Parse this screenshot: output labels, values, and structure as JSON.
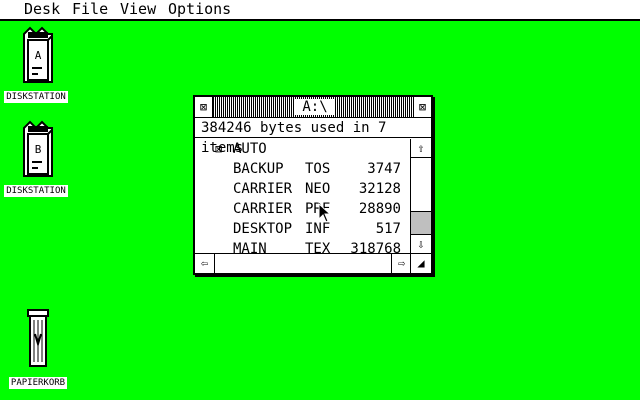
{
  "menubar": {
    "items": [
      "Desk",
      "File",
      "View",
      "Options"
    ]
  },
  "desktop": {
    "icons": [
      {
        "label": "DISKSTATION",
        "drive": "A",
        "type": "drive-icon"
      },
      {
        "label": "DISKSTATION",
        "drive": "B",
        "type": "drive-icon"
      },
      {
        "label": "PAPIERKORB",
        "type": "trash-icon"
      }
    ]
  },
  "window": {
    "title": "A:\\",
    "info": "384246 bytes used in 7 items",
    "close_glyph": "⊠",
    "full_glyph": "⊠",
    "files": [
      {
        "icon": "⊠",
        "name": "AUTO",
        "ext": "",
        "size": ""
      },
      {
        "icon": "",
        "name": "BACKUP",
        "ext": "TOS",
        "size": "3747"
      },
      {
        "icon": "",
        "name": "CARRIER",
        "ext": "NEO",
        "size": "32128"
      },
      {
        "icon": "",
        "name": "CARRIER",
        "ext": "PRF",
        "size": "28890"
      },
      {
        "icon": "",
        "name": "DESKTOP",
        "ext": "INF",
        "size": "517"
      },
      {
        "icon": "",
        "name": "MAIN",
        "ext": "TEX",
        "size": "318768"
      }
    ],
    "scroll": {
      "up": "⇧",
      "down": "⇩",
      "left": "⇦",
      "right": "⇨",
      "visible_fraction": 0.71,
      "position": 0
    },
    "resize_glyph": "◢"
  }
}
